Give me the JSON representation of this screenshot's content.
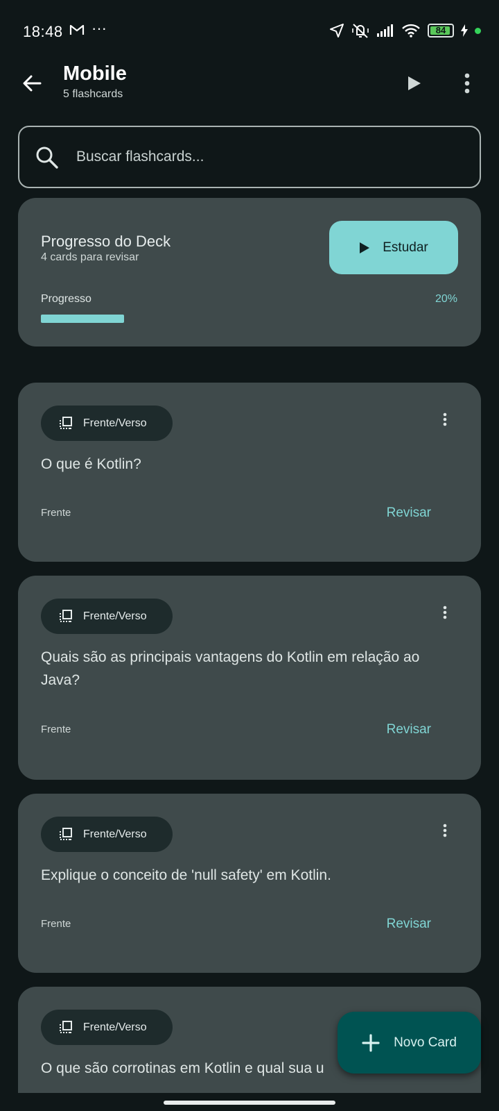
{
  "status_bar": {
    "time": "18:48",
    "more": "···",
    "battery": "84",
    "icons": [
      "gmail-icon",
      "location-arrow-icon",
      "mute-vibrate-icon",
      "signal-icon",
      "wifi-icon",
      "battery-icon",
      "charging-icon",
      "green-dot"
    ]
  },
  "app_bar": {
    "title": "Mobile",
    "subtitle": "5 flashcards",
    "icons": [
      "back-arrow-icon",
      "play-icon",
      "more-vert-icon"
    ]
  },
  "search": {
    "placeholder": "Buscar flashcards..."
  },
  "progress_card": {
    "title": "Progresso do Deck",
    "subtitle": "4 cards para revisar",
    "study_label": "Estudar",
    "progress_label": "Progresso",
    "progress_value": "20%",
    "progress_fraction": 0.2
  },
  "cards": [
    {
      "type": "Frente/Verso",
      "question": "O que é Kotlin?",
      "side": "Frente",
      "action": "Revisar"
    },
    {
      "type": "Frente/Verso",
      "question": "Quais são as principais vantagens do Kotlin em relação ao Java?",
      "side": "Frente",
      "action": "Revisar"
    },
    {
      "type": "Frente/Verso",
      "question": "Explique o conceito de 'null safety' em Kotlin.",
      "side": "Frente",
      "action": "Revisar"
    },
    {
      "type": "Frente/Verso",
      "question": "O que são corrotinas em Kotlin e qual sua u"
    }
  ],
  "fab": {
    "label": "Novo Card",
    "icon": "plus-icon"
  },
  "colors": {
    "background": "#0f1718",
    "card": "#3f4a4b",
    "accent": "#80d5d4",
    "fab": "#005352",
    "chip": "#1e2b2c"
  }
}
